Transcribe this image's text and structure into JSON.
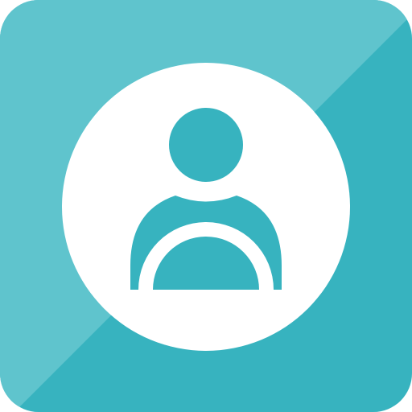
{
  "icon": {
    "name": "user-profile-icon",
    "glyph": "person-avatar",
    "colors": {
      "tile_light": "#5FC4CD",
      "tile_dark": "#37B3BF",
      "circle": "#FFFFFF",
      "figure": "#37B3BF"
    }
  }
}
